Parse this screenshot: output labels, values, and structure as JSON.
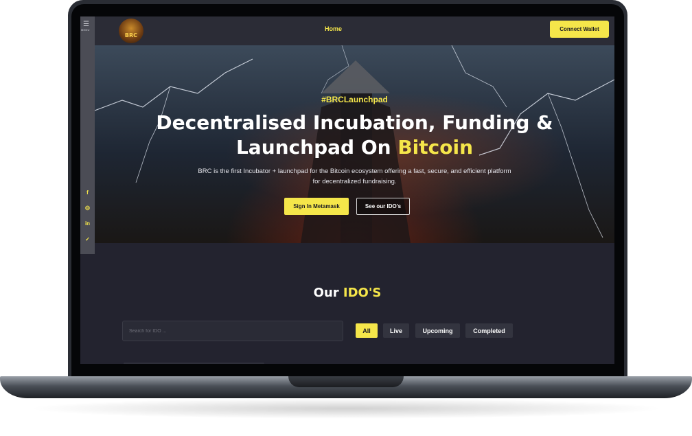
{
  "header": {
    "logo_text": "BRC",
    "nav_home": "Home",
    "connect_wallet": "Connect Wallet"
  },
  "sidebar": {
    "menu_label": "MENU",
    "socials": [
      "facebook-icon",
      "instagram-icon",
      "linkedin-icon",
      "twitter-icon"
    ],
    "social_glyphs": [
      "f",
      "◎",
      "in",
      "✓"
    ]
  },
  "hero": {
    "hashtag": "#BRCLaunchpad",
    "title_line1": "Decentralised Incubation, Funding &",
    "title_line2_prefix": "Launchpad On ",
    "title_line2_highlight": "Bitcoin",
    "subtitle": "BRC is the first Incubator + launchpad for the Bitcoin ecosystem offering a fast, secure, and efficient platform for decentralized fundraising.",
    "primary_button": "Sign In Metamask",
    "secondary_button": "See our IDO's"
  },
  "idos": {
    "title_prefix": "Our ",
    "title_highlight": "IDO'S",
    "search_placeholder": "Search for IDO ...",
    "filters": [
      "All",
      "Live",
      "Upcoming",
      "Completed"
    ],
    "active_filter": "All"
  },
  "colors": {
    "accent": "#f5e64a",
    "background": "#23232f",
    "topbar": "#2b2c36"
  }
}
